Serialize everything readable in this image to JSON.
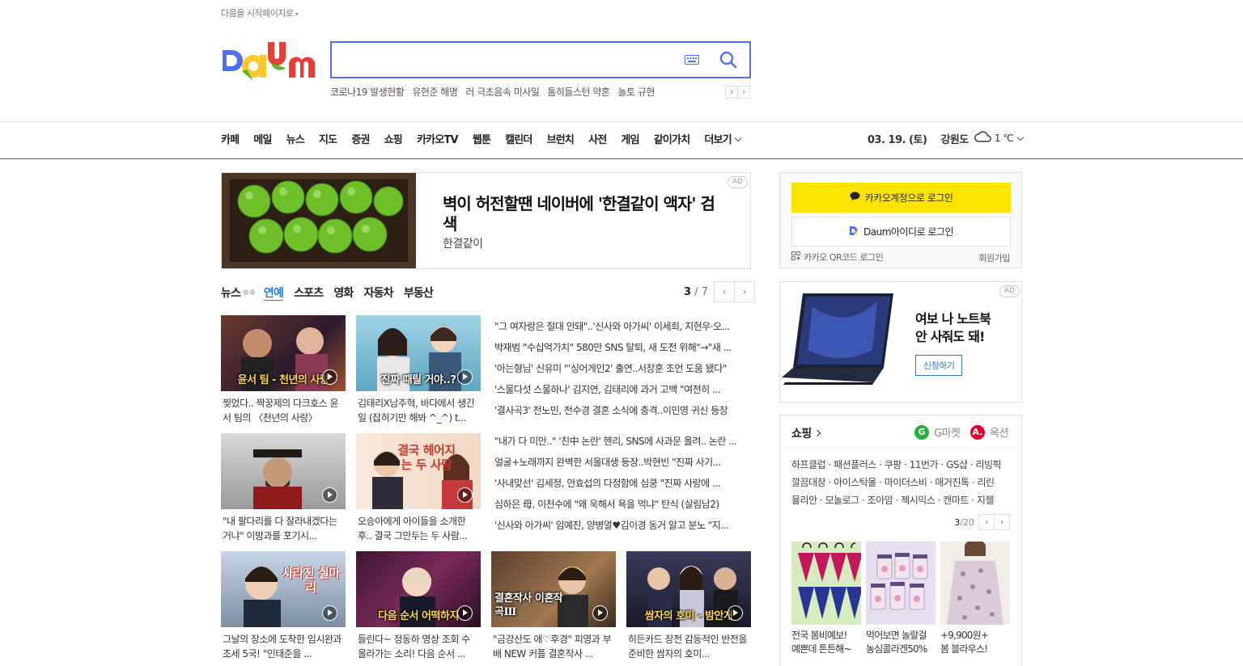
{
  "top": {
    "start_page_link": "다음을 시작페이지로"
  },
  "search": {
    "placeholder": "",
    "value": ""
  },
  "trends": [
    "코로나19 발생현황",
    "유현준 해명",
    "러 극초음속 미사일",
    "톰히들스턴 약혼",
    "놀토 규현"
  ],
  "gnb": {
    "items": [
      "카페",
      "메일",
      "뉴스",
      "지도",
      "증권",
      "쇼핑",
      "카카오TV",
      "웹툰",
      "캘린더",
      "브런치",
      "사전",
      "게임",
      "같이가치"
    ],
    "more": "더보기"
  },
  "weather": {
    "date": "03. 19. (토)",
    "region": "강원도",
    "temp": "1 ℃",
    "condition_icon": "cloud-icon"
  },
  "ad_banner": {
    "title": "벽이 허전할땐 네이버에 '한결같이 액자' 검색",
    "sub": "한결같이",
    "ad_label": "AD"
  },
  "news": {
    "tabs": [
      "뉴스",
      "연예",
      "스포츠",
      "영화",
      "자동차",
      "부동산"
    ],
    "active_tab": "연예",
    "page_current": "3",
    "page_total": "/ 7",
    "cards": [
      {
        "caption": "찢었다.. 짝꿍제의 다크호스 윤서 팀의 〈천년의 사랑〉",
        "overlay": "윤서 팀 - 천년의 사랑"
      },
      {
        "caption": "김태리X남주혁, 바다에서 생긴 일 (잡히기만 해봐 ^_^) t...",
        "overlay": "진짜 때릴 거야..?"
      },
      {
        "caption": "\"내 팔다리를 다 잘라내겠다는 거냐\" 이방과를 포기시...",
        "overlay": ""
      },
      {
        "caption": "오승아에게 아이들을 소개한 후.. 결국 그만두는 두 사람...",
        "overlay": "결국 헤어지는 두 사람"
      },
      {
        "caption": "그날의 장소에 도착한 임시완과 조세 5국! \"인태준을 ...",
        "overlay": "사라진 실마리"
      },
      {
        "caption": "들린다~ 정동하 영상 조회 수 올라가는 소리! 다음 순서 ...",
        "overlay": "다음 순서 어떡하지"
      },
      {
        "caption": "\"금강산도 애♡후경\" 피영과 부배 NEW 커플 결혼작사 ...",
        "overlay": "결혼작사 이혼작곡Ⅲ"
      },
      {
        "caption": "히든카드 장전 감동적인 반전을 준비한 쌈자의 호미...",
        "overlay": "쌈자의 호미 - 밤안개"
      }
    ],
    "headlines_a": [
      "\"그 여자랑은 절대 안돼\"..'신사와 아가씨' 이세희, 지현우·오...",
      "박재범 \"수십억가치\" 580만 SNS 탈퇴, 새 도전 위해\"→\"새 ...",
      "'아는형님' 신유미 \"'싱어게인2' 출연..서장훈 조언 도움 됐다\"",
      "'스물다섯 스물하나' 김지연, 김태리에 과거 고백 \"여전히 ...",
      "'결사곡3' 전노민, 전수경 결혼 소식에 충격..이민영 귀신 등장"
    ],
    "headlines_b": [
      "\"내가 다 미안..\" '친中 논란' 헨리, SNS에 사과문 올려.. 논란 ...",
      "얼굴+노래까지 완벽한 서울대생 등장..박현빈 \"진짜 사기...",
      "'사내맞선' 김세정, 안효섭의 다정함에 심쿵 \"진짜 사랑에 ...",
      "심하은 母, 이천수에 \"왜 욱해서 욕을 먹냐\" 탄식 (살림남2)",
      "'신사와 아가씨' 임예진, 양병열♥김이경 동거 알고 분노 \"지..."
    ]
  },
  "login": {
    "kakao_label": "카카오계정으로 로그인",
    "daum_label": "Daum아이디로 로그인",
    "qr_label": "카카오 QR코드 로그인",
    "join_label": "회원가입"
  },
  "ad2": {
    "title_line1": "여보 나 노트북",
    "title_line2": "안 사줘도 돼!",
    "button": "신청하기",
    "ad_label": "AD"
  },
  "shopping": {
    "title": "쇼핑",
    "gmarket": "G마켓",
    "auction": "옥션",
    "links": [
      "하프클럽 · 패션플러스 · 쿠팡 · 11번가 · GS샵 · 리빙픽",
      "깔끔대장 · 아이스탁몰 · 마이더스비 · 매거진톡 · 리린",
      "뮬리안 · 모놀로그 · 조아맘 · 젝시믹스 · 캔마트 · 지젤"
    ],
    "page_current": "3",
    "page_total": "/20",
    "products": [
      {
        "line1": "전국 봄비예보!",
        "line2": "예쁜데 튼튼해~"
      },
      {
        "line1": "먹어보면 놀랄걸",
        "line2": "농심콜라겐50%"
      },
      {
        "line1": "+9,900원+",
        "line2": "봄 블라우스!"
      }
    ]
  },
  "colors": {
    "accent": "#4e70f4",
    "active_tab": "#1f7bd8",
    "kakao": "#fee500",
    "gmarket": "#26b13c",
    "auction": "#e4002b"
  }
}
